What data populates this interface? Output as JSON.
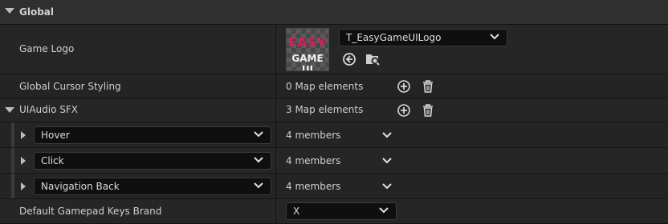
{
  "section": {
    "title": "Global"
  },
  "game_logo": {
    "label": "Game Logo",
    "asset_name": "T_EasyGameUILogo",
    "thumb_line1": "EASY",
    "thumb_line2": "GAME UI"
  },
  "cursor_styling": {
    "label": "Global Cursor Styling",
    "value": "0 Map elements"
  },
  "ui_audio": {
    "label": "UIAudio SFX",
    "value": "3 Map elements",
    "entries": [
      {
        "key": "Hover",
        "value": "4 members"
      },
      {
        "key": "Click",
        "value": "4 members"
      },
      {
        "key": "Navigation Back",
        "value": "4 members"
      }
    ]
  },
  "gamepad_brand": {
    "label": "Default Gamepad Keys Brand",
    "value": "X"
  },
  "icons": {
    "expand": "triangle-down-icon",
    "collapse": "triangle-right-icon",
    "dropdown": "chevron-down-icon",
    "add": "plus-circle-icon",
    "delete": "trash-icon",
    "use_selected": "arrow-left-circle-icon",
    "browse": "folder-search-icon"
  },
  "colors": {
    "background": "#262626",
    "dropdown_bg": "#0f0f0f",
    "logo_accent": "#d81e5b"
  }
}
